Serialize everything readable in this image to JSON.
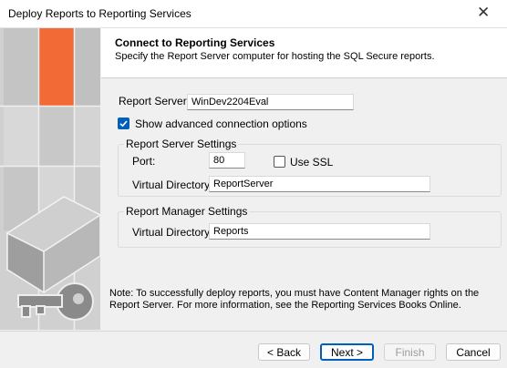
{
  "window": {
    "title": "Deploy Reports to Reporting Services",
    "close_glyph": "✕"
  },
  "header": {
    "title": "Connect to Reporting Services",
    "subtitle": "Specify the Report Server computer for hosting the SQL Secure reports."
  },
  "form": {
    "report_server_label": "Report Server:",
    "report_server_value": "WinDev2204Eval",
    "advanced_checkbox_label": "Show advanced connection options",
    "advanced_checked": true,
    "server_group": {
      "title": "Report Server Settings",
      "port_label": "Port:",
      "port_value": "80",
      "ssl_label": "Use SSL",
      "ssl_checked": false,
      "vdir_label": "Virtual Directory:",
      "vdir_value": "ReportServer"
    },
    "manager_group": {
      "title": "Report Manager Settings",
      "vdir_label": "Virtual Directory:",
      "vdir_value": "Reports"
    }
  },
  "note": "Note:  To successfully deploy reports, you must have Content Manager rights on the Report Server.  For more information, see the Reporting Services Books Online.",
  "buttons": {
    "back": "< Back",
    "next": "Next >",
    "finish": "Finish",
    "cancel": "Cancel"
  },
  "colors": {
    "accent": "#005fb8",
    "wizard_orange": "#f26a35"
  }
}
